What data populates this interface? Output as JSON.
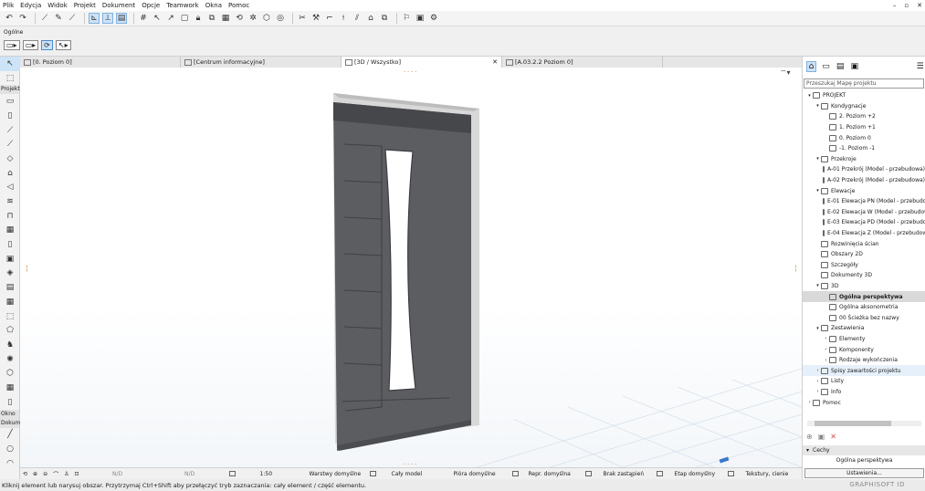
{
  "menu": [
    "Plik",
    "Edycja",
    "Widok",
    "Projekt",
    "Dokument",
    "Opcje",
    "Teamwork",
    "Okna",
    "Pomoc"
  ],
  "window_controls": [
    "–",
    "▫",
    "✕"
  ],
  "infobox": {
    "label": "Ogólne"
  },
  "toolbox": {
    "section_project": "Projekt",
    "section_window": "Okno",
    "section_docs": "Dokume"
  },
  "tabs": [
    {
      "label": "[0. Poziom 0]"
    },
    {
      "label": "[Centrum informacyjne]"
    },
    {
      "label": "[3D / Wszystko]",
      "close": "✕"
    },
    {
      "label": "[A.03.2.2 Poziom 0]"
    }
  ],
  "navigator": {
    "search_placeholder": "Przeszukaj Mapę projektu",
    "tree": [
      {
        "level": 0,
        "toggle": "▾",
        "label": "PROJEKT"
      },
      {
        "level": 1,
        "toggle": "▾",
        "label": "Kondygnacje"
      },
      {
        "level": 2,
        "toggle": "",
        "label": "2. Poziom +2"
      },
      {
        "level": 2,
        "toggle": "",
        "label": "1. Poziom +1"
      },
      {
        "level": 2,
        "toggle": "",
        "label": "0. Poziom 0"
      },
      {
        "level": 2,
        "toggle": "",
        "label": "-1. Poziom -1"
      },
      {
        "level": 1,
        "toggle": "▾",
        "label": "Przekroje"
      },
      {
        "level": 2,
        "toggle": "",
        "label": "A-01 Przekrój (Model - przebudowa)"
      },
      {
        "level": 2,
        "toggle": "",
        "label": "A-02 Przekrój (Model - przebudowa)"
      },
      {
        "level": 1,
        "toggle": "▾",
        "label": "Elewacje"
      },
      {
        "level": 2,
        "toggle": "",
        "label": "E-01 Elewacja PN (Model - przebudowa)"
      },
      {
        "level": 2,
        "toggle": "",
        "label": "E-02 Elewacja W (Model - przebudowa)"
      },
      {
        "level": 2,
        "toggle": "",
        "label": "E-03 Elewacja PD (Model - przebudowa)"
      },
      {
        "level": 2,
        "toggle": "",
        "label": "E-04 Elewacja Z (Model - przebudowa)"
      },
      {
        "level": 1,
        "toggle": "",
        "label": "Rozwinięcia ścian"
      },
      {
        "level": 1,
        "toggle": "",
        "label": "Obszary 2D"
      },
      {
        "level": 1,
        "toggle": "",
        "label": "Szczegóły"
      },
      {
        "level": 1,
        "toggle": "",
        "label": "Dokumenty 3D"
      },
      {
        "level": 1,
        "toggle": "▾",
        "label": "3D"
      },
      {
        "level": 2,
        "toggle": "",
        "label": "Ogólna perspektywa",
        "selected": true
      },
      {
        "level": 2,
        "toggle": "",
        "label": "Ogólna aksonometria"
      },
      {
        "level": 2,
        "toggle": "",
        "label": "00 Ścieżka bez nazwy"
      },
      {
        "level": 1,
        "toggle": "▾",
        "label": "Zestawienia"
      },
      {
        "level": 2,
        "toggle": "›",
        "label": "Elementy"
      },
      {
        "level": 2,
        "toggle": "›",
        "label": "Komponenty"
      },
      {
        "level": 2,
        "toggle": "›",
        "label": "Rodzaje wykończenia"
      },
      {
        "level": 1,
        "toggle": "›",
        "label": "Spisy zawartości projektu",
        "highlight": true
      },
      {
        "level": 1,
        "toggle": "›",
        "label": "Listy"
      },
      {
        "level": 1,
        "toggle": "›",
        "label": "Info"
      },
      {
        "level": 0,
        "toggle": "›",
        "label": "Pomoc"
      }
    ],
    "properties_header": "Cechy",
    "properties_view": "Ogólna perspektywa",
    "settings_button": "Ustawienia..."
  },
  "statusbar": {
    "nd1": "N/D",
    "nd2": "N/D",
    "scale": "1:50",
    "layers": "Warstwy domyślne",
    "model": "Cały model",
    "pens": "Pióra domyślne",
    "repr": "Repr. domyślna",
    "override": "Brak zastąpień",
    "phase": "Etap domyślny",
    "textures": "Tekstury, cienie"
  },
  "hint": "Kliknij element lub narysuj obszar. Przytrzymaj Ctrl+Shift aby przełączyć tryb zaznaczania: cały element / część elementu.",
  "brand": "GRAPHISOFT ID",
  "colors": {
    "door_panel": "#5b5d61",
    "door_frame": "#d8d8d8",
    "selection": "#cde3f7",
    "accent": "#2f7dd3"
  }
}
